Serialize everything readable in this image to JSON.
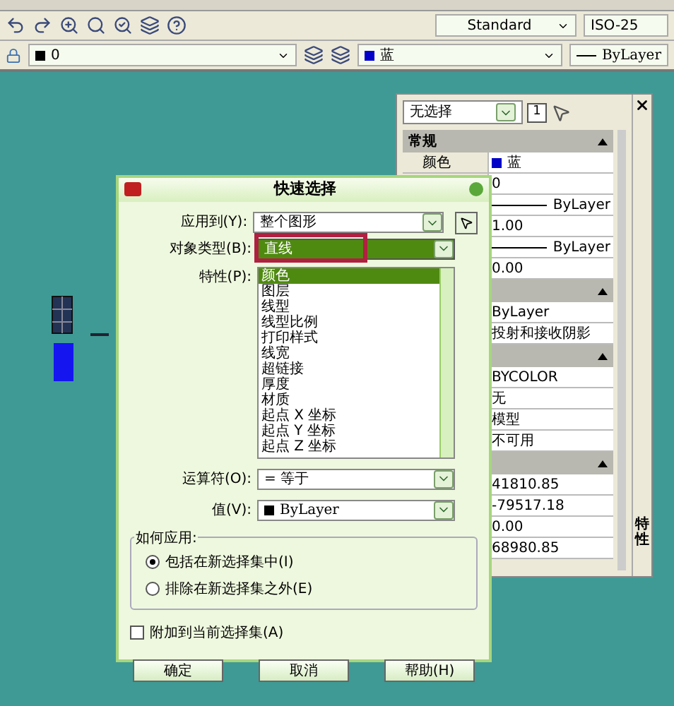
{
  "toolbar": {
    "text_style": "Standard",
    "dim_style": "ISO-25",
    "layer": "0",
    "color_name": "蓝",
    "linetype": "ByLayer"
  },
  "properties_palette": {
    "selection": "无选择",
    "count": "1",
    "side_title": "特性",
    "sections": [
      {
        "title": "常规",
        "rows": [
          {
            "label": "颜色",
            "value": "蓝",
            "kind": "color"
          },
          {
            "value": "0",
            "kind": "text"
          },
          {
            "value": "ByLayer",
            "kind": "linetype"
          },
          {
            "value": "1.00",
            "kind": "text"
          },
          {
            "value": "ByLayer",
            "kind": "linetype"
          },
          {
            "value": "0.00",
            "kind": "text"
          }
        ]
      },
      {
        "rows": [
          {
            "value": "ByLayer",
            "kind": "text"
          },
          {
            "value": "投射和接收阴影",
            "kind": "text"
          }
        ]
      },
      {
        "rows": [
          {
            "value": "BYCOLOR",
            "kind": "text"
          },
          {
            "value": "无",
            "kind": "text"
          },
          {
            "value": "模型",
            "kind": "text"
          },
          {
            "value": "不可用",
            "kind": "text"
          }
        ]
      },
      {
        "rows": [
          {
            "value": "41810.85",
            "kind": "text"
          },
          {
            "value": "-79517.18",
            "kind": "text"
          },
          {
            "value": "0.00",
            "kind": "text"
          },
          {
            "value": "68980.85",
            "kind": "text"
          }
        ]
      }
    ]
  },
  "dialog": {
    "title": "快速选择",
    "fields": [
      {
        "label": "应用到(Y):",
        "value": "整个图形",
        "highlighted": false
      },
      {
        "label": "对象类型(B):",
        "value": "直线",
        "highlighted": true
      }
    ],
    "properties_label": "特性(P):",
    "properties": [
      {
        "label": "颜色",
        "selected": true
      },
      {
        "label": "图层",
        "selected": false
      },
      {
        "label": "线型",
        "selected": false
      },
      {
        "label": "线型比例",
        "selected": false
      },
      {
        "label": "打印样式",
        "selected": false
      },
      {
        "label": "线宽",
        "selected": false
      },
      {
        "label": "超链接",
        "selected": false
      },
      {
        "label": "厚度",
        "selected": false
      },
      {
        "label": "材质",
        "selected": false
      },
      {
        "label": "起点 X 坐标",
        "selected": false
      },
      {
        "label": "起点 Y 坐标",
        "selected": false
      },
      {
        "label": "起点 Z 坐标",
        "selected": false
      }
    ],
    "operator": {
      "label": "运算符(O):",
      "value": "= 等于"
    },
    "value_field": {
      "label": "值(V):",
      "value": "ByLayer"
    },
    "apply_group": {
      "title": "如何应用:",
      "options": [
        {
          "label": "包括在新选择集中(I)",
          "selected": true
        },
        {
          "label": "排除在新选择集之外(E)",
          "selected": false
        }
      ]
    },
    "append": {
      "label": "附加到当前选择集(A)",
      "checked": false
    },
    "buttons": [
      "确定",
      "取消",
      "帮助(H)"
    ]
  }
}
